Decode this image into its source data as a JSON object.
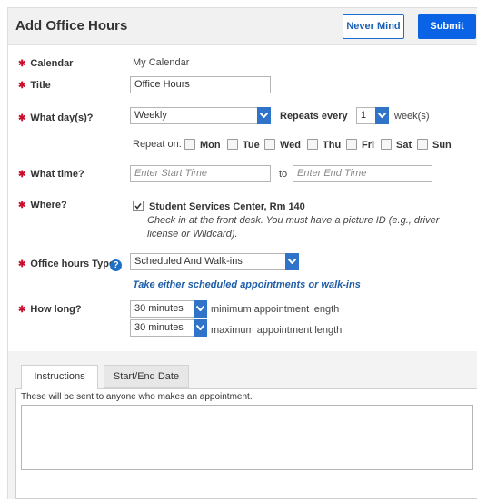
{
  "header": {
    "title": "Add Office Hours",
    "never_mind_label": "Never Mind",
    "submit_label": "Submit"
  },
  "calendar": {
    "label": "Calendar",
    "value": "My Calendar"
  },
  "title_field": {
    "label": "Title",
    "value": "Office Hours"
  },
  "days": {
    "label": "What day(s)?",
    "frequency": "Weekly",
    "repeats_every_label": "Repeats every",
    "interval": "1",
    "unit_label": "week(s)",
    "repeat_on_label": "Repeat on:",
    "weekdays": [
      "Mon",
      "Tue",
      "Wed",
      "Thu",
      "Fri",
      "Sat",
      "Sun"
    ]
  },
  "time": {
    "label": "What time?",
    "start_placeholder": "Enter Start Time",
    "to_label": "to",
    "end_placeholder": "Enter End Time"
  },
  "where": {
    "label": "Where?",
    "location": "Student Services Center, Rm 140",
    "note": "Check in at the front desk. You must have a picture ID (e.g., driver license or Wildcard)."
  },
  "type": {
    "label": "Office hours Type",
    "value": "Scheduled And Walk-ins",
    "hint": "Take either scheduled appointments or walk-ins"
  },
  "length": {
    "label": "How long?",
    "min_value": "30 minutes",
    "min_label": "minimum appointment length",
    "max_value": "30 minutes",
    "max_label": "maximum appointment length"
  },
  "tabs": {
    "instructions": "Instructions",
    "start_end": "Start/End Date",
    "panel_text": "These will be sent to anyone who makes an appointment."
  },
  "colors": {
    "primary": "#0a63e5",
    "required": "#c8102e",
    "note_blue": "#1f5ea8"
  }
}
